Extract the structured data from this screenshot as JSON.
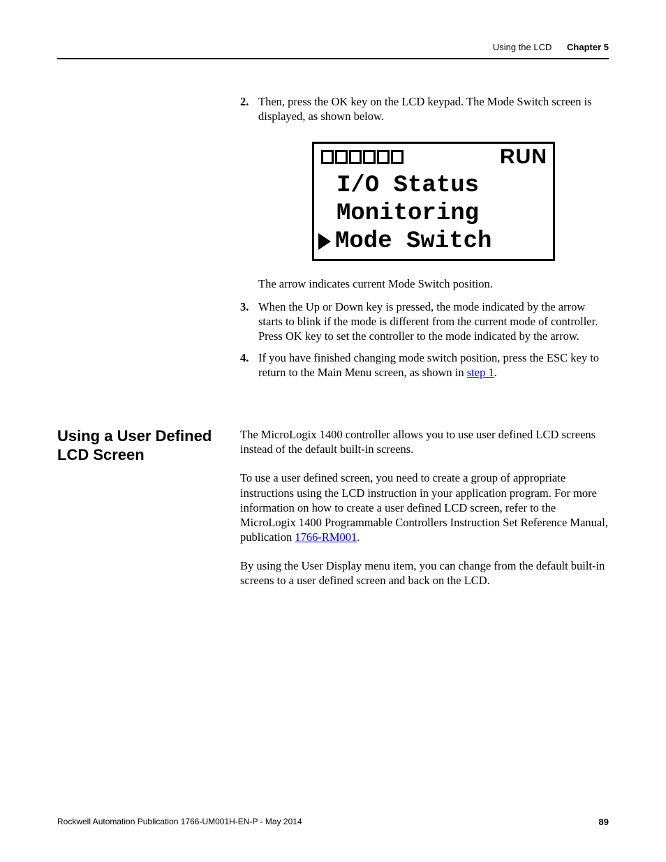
{
  "header": {
    "section_title": "Using the LCD",
    "chapter_label": "Chapter 5"
  },
  "steps": {
    "s2": "Then, press the OK key on the LCD keypad. The Mode Switch screen is displayed, as shown below.",
    "s3": "When the Up or Down key is pressed, the mode indicated by the arrow starts to blink if the mode is different from the current mode of controller. Press OK key to set the controller to the mode indicated by the arrow.",
    "s4_a": "If you have finished changing mode switch position, press the ESC key to return to the Main Menu screen, as shown in ",
    "s4_link": "step 1",
    "s4_b": "."
  },
  "lcd": {
    "status": "RUN",
    "line1": "I/O Status",
    "line2": "Monitoring",
    "line3": "Mode Switch"
  },
  "after_fig": "The arrow indicates current Mode Switch position.",
  "section2": {
    "heading": "Using a User Defined LCD Screen",
    "p1": "The MicroLogix 1400 controller allows you to use user defined LCD screens instead of the default built-in screens.",
    "p2_a": "To use a user defined screen, you need to create a group of appropriate instructions using the LCD instruction in your application program. For more information on how to create a user defined LCD screen, refer to the MicroLogix 1400 Programmable Controllers Instruction Set Reference Manual, publication ",
    "p2_link": "1766-RM001",
    "p2_b": ".",
    "p3": "By using the User Display menu item, you can change from the default built-in screens to a user defined screen and back on the LCD."
  },
  "footer": {
    "pub": "Rockwell Automation Publication 1766-UM001H-EN-P - May 2014",
    "page": "89"
  }
}
